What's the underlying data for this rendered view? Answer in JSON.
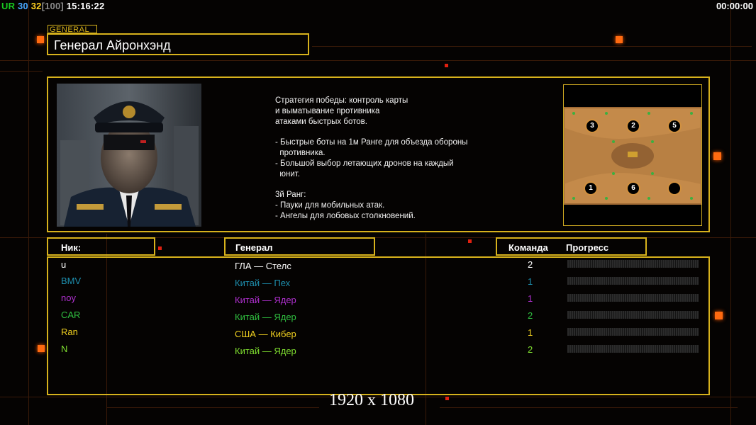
{
  "hud": {
    "ur_label": "UR",
    "num1": "30",
    "num2": "32",
    "bracket": "[100]",
    "clock": "15:16:22",
    "timer": "00:00:00"
  },
  "general": {
    "tag": "GENERAL",
    "name": "Генерал Айронхэнд"
  },
  "description": [
    "Стратегия победы: контроль карты",
    "и выматывание противника",
    "атаками быстрых ботов.",
    "",
    "- Быстрые боты на 1м Ранге для объезда обороны",
    "  противника.",
    "- Большой выбор летающих дронов на каждый",
    "  юнит.",
    "",
    "3й Ранг:",
    "- Пауки для мобильных атак.",
    "- Ангелы для лобовых столкновений."
  ],
  "map": {
    "slots": [
      "3",
      "2",
      "5",
      "1",
      "6",
      ""
    ]
  },
  "headers": {
    "nick": "Ник:",
    "general": "Генерал",
    "team": "Команда",
    "progress": "Прогресс"
  },
  "players": [
    {
      "nick": "u",
      "general": "ГЛА — Стелс",
      "team": "2",
      "color": "#ffffff"
    },
    {
      "nick": "BMV",
      "general": "Китай — Пех",
      "team": "1",
      "color": "#1e90b0"
    },
    {
      "nick": "noy",
      "general": "Китай — Ядер",
      "team": "1",
      "color": "#b030d0"
    },
    {
      "nick": "CAR",
      "general": "Китай — Ядер",
      "team": "2",
      "color": "#30c040"
    },
    {
      "nick": "Ran",
      "general": "США — Кибер",
      "team": "1",
      "color": "#f0d020"
    },
    {
      "nick": "N",
      "general": "Китай — Ядер",
      "team": "2",
      "color": "#80e030"
    }
  ],
  "resolution": "1920 x 1080"
}
